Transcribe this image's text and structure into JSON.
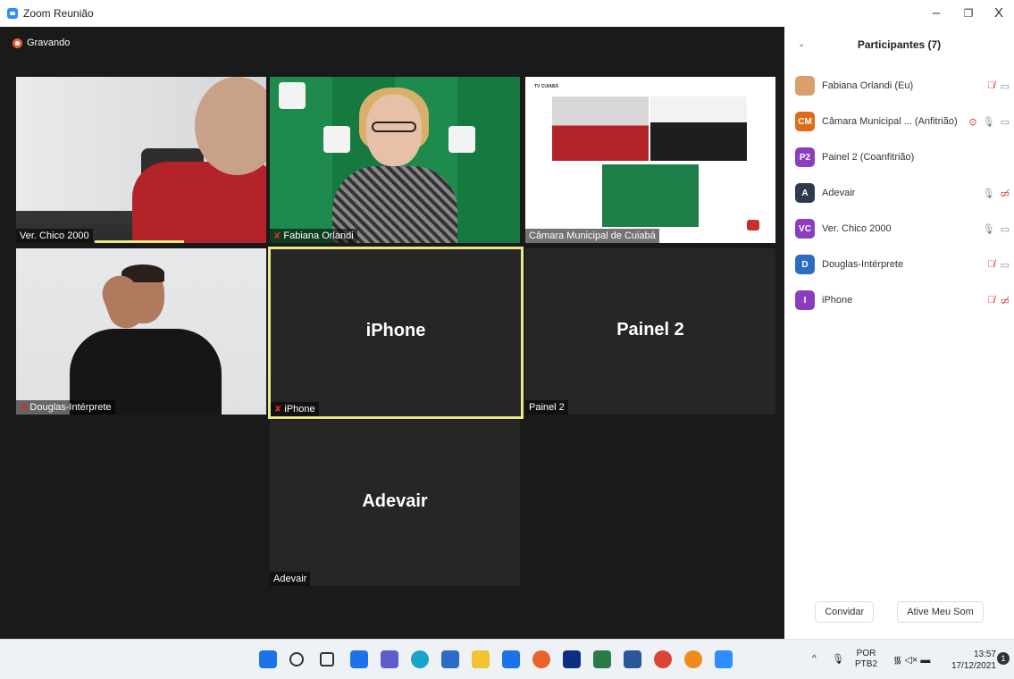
{
  "window": {
    "title": "Zoom Reunião",
    "min_glyph": "–",
    "max_glyph": "❐",
    "close_glyph": "X"
  },
  "recording": {
    "label": "Gravando"
  },
  "tiles": [
    {
      "id": "chico",
      "name": "Ver. Chico 2000",
      "muted": false
    },
    {
      "id": "fabiana",
      "name": "Fabiana Orlandi",
      "muted": true
    },
    {
      "id": "camara",
      "name": "Câmara Municipal de Cuiabá",
      "muted": false
    },
    {
      "id": "douglas",
      "name": "Douglas-Intérprete",
      "muted": true
    },
    {
      "id": "iphone",
      "name": "iPhone",
      "big": "iPhone",
      "muted": true,
      "active": true
    },
    {
      "id": "painel2",
      "name": "Painel 2",
      "big": "Painel 2",
      "muted": false
    },
    {
      "id": "adevair",
      "name": "Adevair",
      "big": "Adevair",
      "muted": false
    }
  ],
  "participants": {
    "title": "Participantes (7)",
    "list": [
      {
        "initials": "",
        "name": "Fabiana Orlandi (Eu)",
        "color": "#d9a06b",
        "mic": "off",
        "cam": "on"
      },
      {
        "initials": "CM",
        "name": "Câmara Municipal ... (Anfitrião)",
        "color": "#e06a1a",
        "mic": "on",
        "cam": "on",
        "rec": true
      },
      {
        "initials": "P2",
        "name": "Painel 2 (Coanfitrião)",
        "color": "#8a3dbf",
        "mic": "",
        "cam": ""
      },
      {
        "initials": "A",
        "name": "Adevair",
        "color": "#2f3a4d",
        "mic": "on",
        "cam": "off"
      },
      {
        "initials": "VC",
        "name": "Ver. Chico 2000",
        "color": "#8a3dbf",
        "mic": "on",
        "cam": "on"
      },
      {
        "initials": "D",
        "name": "Douglas-Intérprete",
        "color": "#2d6cc4",
        "mic": "off",
        "cam": "on"
      },
      {
        "initials": "I",
        "name": "iPhone",
        "color": "#8a3dbf",
        "mic": "off",
        "cam": "off"
      }
    ],
    "invite_label": "Convidar",
    "unmute_label": "Ative Meu Som"
  },
  "taskbar": {
    "lang_top": "POR",
    "lang_bottom": "PTB2",
    "time": "13:57",
    "date": "17/12/2021",
    "notif_count": "1",
    "icons": [
      {
        "name": "windows-start-icon",
        "color": "#1a73e8"
      },
      {
        "name": "search-icon",
        "color": "#333333"
      },
      {
        "name": "task-view-icon",
        "color": "#333333"
      },
      {
        "name": "widgets-icon",
        "color": "#1a73e8"
      },
      {
        "name": "chat-icon",
        "color": "#5b5fc7"
      },
      {
        "name": "edge-browser-icon",
        "color": "#1aa3c9"
      },
      {
        "name": "store-icon",
        "color": "#2d6cc4"
      },
      {
        "name": "file-explorer-icon",
        "color": "#f2c230"
      },
      {
        "name": "mail-icon",
        "color": "#1a73e8"
      },
      {
        "name": "firefox-icon",
        "color": "#e8622a"
      },
      {
        "name": "dropbox-icon",
        "color": "#0d2f81"
      },
      {
        "name": "calculator-icon",
        "color": "#2a7a4a"
      },
      {
        "name": "word-icon",
        "color": "#2b579a"
      },
      {
        "name": "chrome-icon",
        "color": "#db4437"
      },
      {
        "name": "avast-icon",
        "color": "#f08a1a"
      },
      {
        "name": "zoom-icon",
        "color": "#2d8cff"
      }
    ]
  }
}
